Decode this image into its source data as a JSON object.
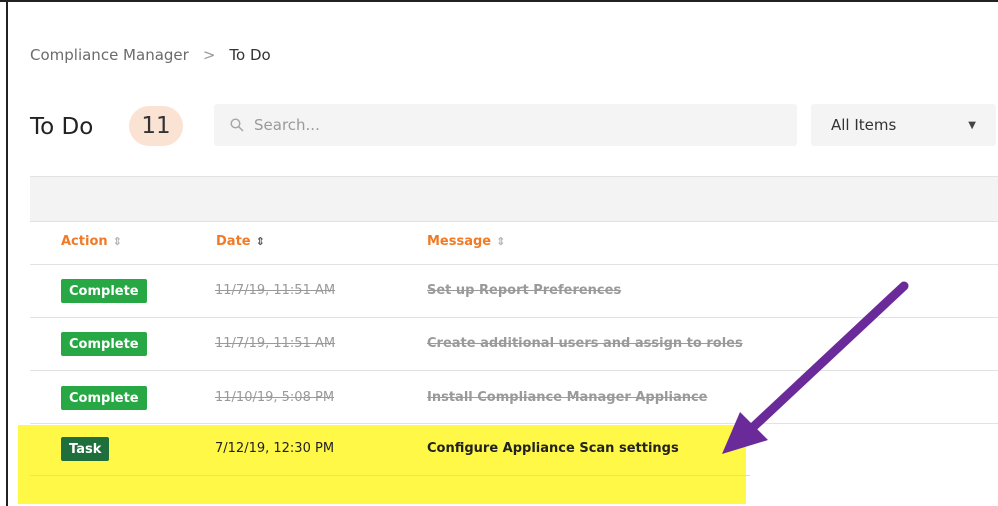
{
  "breadcrumb": {
    "root": "Compliance Manager",
    "separator": ">",
    "current": "To Do"
  },
  "header": {
    "title": "To Do",
    "count": "11"
  },
  "search": {
    "placeholder": "Search..."
  },
  "filter": {
    "selected": "All Items"
  },
  "table": {
    "columns": [
      {
        "label": "Action"
      },
      {
        "label": "Date"
      },
      {
        "label": "Message"
      }
    ],
    "rows": [
      {
        "action": "Complete",
        "date": "11/7/19, 11:51 AM",
        "message": "Set up Report Preferences",
        "status": "done"
      },
      {
        "action": "Complete",
        "date": "11/7/19, 11:51 AM",
        "message": "Create additional users and assign to roles",
        "status": "done"
      },
      {
        "action": "Complete",
        "date": "11/10/19, 5:08 PM",
        "message": "Install Compliance Manager Appliance",
        "status": "done"
      },
      {
        "action": "Task",
        "date": "7/12/19, 12:30 PM",
        "message": "Configure Appliance Scan settings",
        "status": "pending"
      }
    ]
  },
  "colors": {
    "accent_orange": "#f07a26",
    "badge_bg": "#fbe3d4",
    "complete_green": "#27a844",
    "task_green": "#1f6f3d",
    "highlight_yellow": "#fff500",
    "annotation_arrow": "#6b2a9a"
  },
  "icons": {
    "search": "search-icon",
    "caret": "chevron-down-icon",
    "sort": "sort-icon"
  }
}
